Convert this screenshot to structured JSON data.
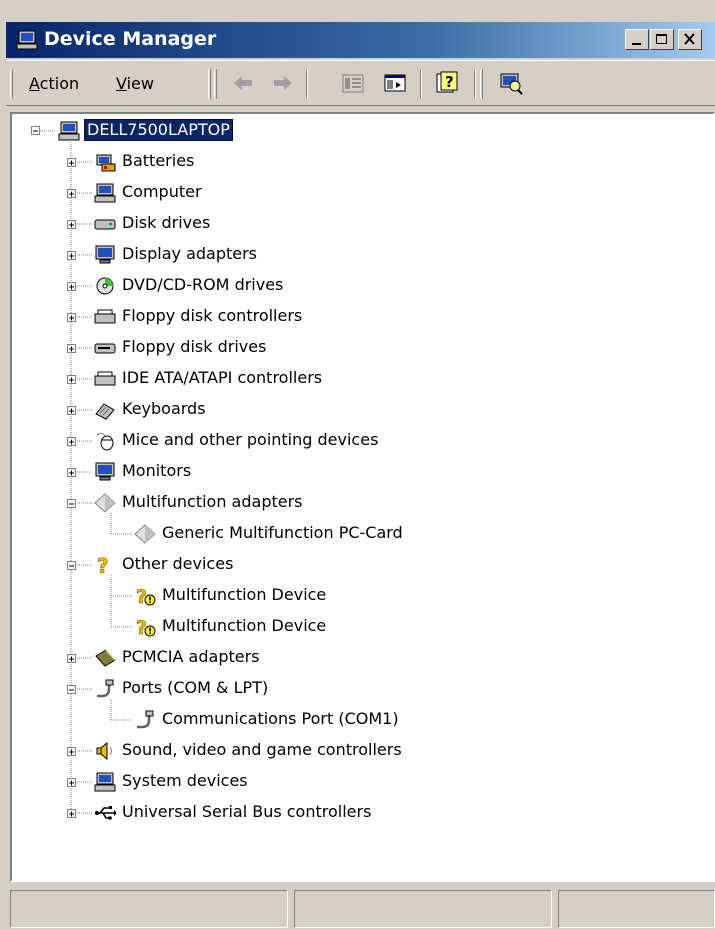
{
  "window": {
    "title": "Device Manager"
  },
  "toolbar": {
    "menus": [
      {
        "label": "Action",
        "accel": "A",
        "rest": "ction"
      },
      {
        "label": "View",
        "accel": "V",
        "rest": "iew"
      }
    ],
    "icons": [
      "back-arrow-icon",
      "forward-arrow-icon",
      "properties-icon",
      "show-hide-tree-icon",
      "help-icon",
      "scan-hardware-icon"
    ]
  },
  "tree": {
    "root": "DELL7500LAPTOP",
    "items": [
      {
        "label": "Batteries",
        "icon": "battery-icon",
        "level": 1,
        "expander": "plus"
      },
      {
        "label": "Computer",
        "icon": "computer-icon",
        "level": 1,
        "expander": "plus"
      },
      {
        "label": "Disk drives",
        "icon": "disk-drive-icon",
        "level": 1,
        "expander": "plus"
      },
      {
        "label": "Display adapters",
        "icon": "display-adapter-icon",
        "level": 1,
        "expander": "plus"
      },
      {
        "label": "DVD/CD-ROM drives",
        "icon": "cd-rom-icon",
        "level": 1,
        "expander": "plus"
      },
      {
        "label": "Floppy disk controllers",
        "icon": "floppy-controller-icon",
        "level": 1,
        "expander": "plus"
      },
      {
        "label": "Floppy disk drives",
        "icon": "floppy-drive-icon",
        "level": 1,
        "expander": "plus"
      },
      {
        "label": "IDE ATA/ATAPI controllers",
        "icon": "ide-controller-icon",
        "level": 1,
        "expander": "plus"
      },
      {
        "label": "Keyboards",
        "icon": "keyboard-icon",
        "level": 1,
        "expander": "plus"
      },
      {
        "label": "Mice and other pointing devices",
        "icon": "mouse-icon",
        "level": 1,
        "expander": "plus"
      },
      {
        "label": "Monitors",
        "icon": "monitor-icon",
        "level": 1,
        "expander": "plus"
      },
      {
        "label": "Multifunction adapters",
        "icon": "multifunction-icon",
        "level": 1,
        "expander": "minus"
      },
      {
        "label": "Generic Multifunction PC-Card",
        "icon": "multifunction-icon",
        "level": 2,
        "expander": "none"
      },
      {
        "label": "Other devices",
        "icon": "unknown-device-icon",
        "level": 1,
        "expander": "minus"
      },
      {
        "label": "Multifunction Device",
        "icon": "unknown-device-warning-icon",
        "level": 2,
        "expander": "none"
      },
      {
        "label": "Multifunction Device",
        "icon": "unknown-device-warning-icon",
        "level": 2,
        "expander": "none"
      },
      {
        "label": "PCMCIA adapters",
        "icon": "pcmcia-icon",
        "level": 1,
        "expander": "plus"
      },
      {
        "label": "Ports (COM & LPT)",
        "icon": "port-icon",
        "level": 1,
        "expander": "minus"
      },
      {
        "label": "Communications Port (COM1)",
        "icon": "port-icon",
        "level": 2,
        "expander": "none"
      },
      {
        "label": "Sound, video and game controllers",
        "icon": "speaker-icon",
        "level": 1,
        "expander": "plus"
      },
      {
        "label": "System devices",
        "icon": "computer-icon",
        "level": 1,
        "expander": "plus"
      },
      {
        "label": "Universal Serial Bus controllers",
        "icon": "usb-icon",
        "level": 1,
        "expander": "plus"
      }
    ]
  },
  "colors": {
    "titlebar_start": "#0a246a",
    "titlebar_end": "#a6caf0",
    "selection": "#0a246a",
    "face": "#d4d0c8"
  }
}
